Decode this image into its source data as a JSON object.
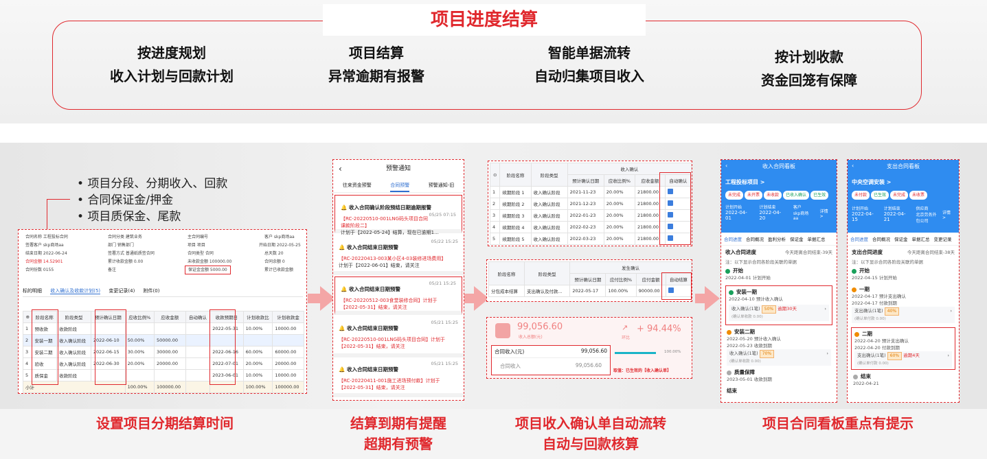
{
  "header": {
    "title": "项目进度结算"
  },
  "features": [
    {
      "l1": "按进度规划",
      "l2": "收入计划与回款计划"
    },
    {
      "l1": "项目结算",
      "l2": "异常逾期有报警"
    },
    {
      "l1": "智能单据流转",
      "l2": "自动归集项目收入"
    },
    {
      "l1": "按计划收款",
      "l2": "资金回笼有保障"
    }
  ],
  "bullets": [
    "项目分段、分期收入、回款",
    "合同保证金/押金",
    "项目质保金、尾款"
  ],
  "captions": {
    "c1": "设置项目分期结算时间",
    "c2a": "结算到期有提醒",
    "c2b": "超期有预警",
    "c3a": "项目收入确认单自动流转",
    "c3b": "自动与回款核算",
    "c4": "项目合同看板重点有提示"
  },
  "panel1": {
    "fields": [
      "合同名称 工程投标合同",
      "合同分类 建筑业务",
      "主合同编号",
      "客户 skp商场aa",
      "签署客户 skp商场aa",
      "部门 销售部门",
      "项目 项目",
      "开始日期 2022-05-25",
      "结束日期 2022-06-24",
      "签署方式 普通纸质签合同",
      "合同类型 合同",
      "总天数 20",
      "合同金额 14.52901",
      "累计收款金额 0.00",
      "未收款金额 100000.00",
      "合同余额 0",
      "合同份数 0155",
      "备注",
      "保证金金额 5000.00",
      "累计已收款金额"
    ],
    "tabs": [
      "标的明细",
      "收入确认及收款计划(5)",
      "变更记录(4)",
      "附件(0)"
    ],
    "head": [
      "阶段名称",
      "阶段类型",
      "预计确认日期",
      "应收比例%",
      "应收金额",
      "自动确认",
      "收款预期日",
      "计划收款比",
      "计划收款金",
      "收款方式"
    ],
    "rows": [
      [
        "预收款",
        "收款阶段",
        "",
        "",
        "",
        "",
        "2022-05-31",
        "10.00%",
        "10000.00"
      ],
      [
        "安装一期",
        "收入确认阶段",
        "2022-06-10",
        "50.00%",
        "50000.00",
        "",
        "",
        "",
        ""
      ],
      [
        "安装二期",
        "收入确认阶段",
        "2022-06-15",
        "30.00%",
        "30000.00",
        "",
        "2022-06-16",
        "60.00%",
        "60000.00"
      ],
      [
        "验收",
        "收入确认阶段",
        "2022-06-30",
        "20.00%",
        "20000.00",
        "",
        "2022-07-01",
        "20.00%",
        "20000.00"
      ],
      [
        "质保金",
        "收款阶段",
        "",
        "",
        "",
        "",
        "2023-06-01",
        "10.00%",
        "10000.00"
      ]
    ],
    "total": [
      "小计",
      "100.00%",
      "100000.00",
      "100.00%",
      "100000.00"
    ]
  },
  "panel2": {
    "title": "预警通知",
    "tabs": [
      "往来资金预警",
      "合同预警",
      "预警通知-旧"
    ],
    "cards": [
      {
        "title": "收入合同确认阶段预结日期逾期报警",
        "time": "05/25 07:15",
        "code": "【RC-20220510-001LNG码头项目合同课款阶段二】",
        "text": "计划于【2022-05-24】结算，现在已逾期1..."
      },
      {
        "title": "收入合同结束日期预警",
        "time": "05/22 15:25",
        "code": "【RC-20220413-003某小区4-03装修进场费用】",
        "text": "计划于【2022-06-01】结束，请关注"
      },
      {
        "title": "收入合同结束日期预警",
        "time": "05/21 15:25",
        "code": "【RC-20220512-003食堂装修合同】计划于",
        "text": "【2022-05-31】结束，请关注"
      },
      {
        "title": "收入合同结束日期预警",
        "time": "05/21 15:25",
        "code": "【RC-20220510-001LNG码头项目合同】计划于",
        "text": "【2022-05-31】结束，请关注"
      },
      {
        "title": "收入合同结束日期预警",
        "time": "05/21 15:25",
        "code": "【RC-20220411-001施工进场预付款】计划于",
        "text": "【2022-05-31】结束，请关注"
      }
    ]
  },
  "panel3": {
    "group": "收入确认",
    "head": [
      "阶段名称",
      "阶段类型",
      "预计确认日期",
      "应收比例%",
      "应收金额",
      "自动确认"
    ],
    "rows": [
      [
        "1",
        "续期阶段 1",
        "收入确认阶段",
        "2021-11-23",
        "20.00%",
        "21800.00"
      ],
      [
        "2",
        "续期阶段 2",
        "收入确认阶段",
        "2021-12-23",
        "20.00%",
        "21800.00"
      ],
      [
        "3",
        "续期阶段 3",
        "收入确认阶段",
        "2022-01-23",
        "20.00%",
        "21800.00"
      ],
      [
        "4",
        "续期阶段 4",
        "收入确认阶段",
        "2022-02-23",
        "20.00%",
        "21800.00"
      ],
      [
        "5",
        "续期阶段 5",
        "收入确认阶段",
        "2022-03-23",
        "20.00%",
        "21800.00"
      ]
    ],
    "t2group": "发生确认",
    "t2head": [
      "阶段名称",
      "阶段类型",
      "预计确认日期",
      "应付比例%",
      "应付金额",
      "自动结算"
    ],
    "t2row": [
      "分包成本结算",
      "支出确认及付款...",
      "2022-05-17",
      "100.00%",
      "90000.00"
    ],
    "amount": "99,056.60",
    "amount_label": "收入总额(元)",
    "growth": "+ 94.44%",
    "growth_label": "环比",
    "row1": [
      "合同收入(元)",
      "99,056.60"
    ],
    "row2": [
      "合同收入",
      "99,056.60"
    ],
    "bar_pct": "100.00%",
    "note": "取值：已生效的【收入确认单】"
  },
  "panel4": {
    "title": "收入合同看板",
    "project": "工程投标项目 >",
    "tags": [
      "未完成",
      "未开票",
      "未收款",
      "已收入确认",
      "已生效"
    ],
    "start_label": "计划开始",
    "start": "2022-04-01",
    "end_label": "计划结束",
    "end": "2022-04-20",
    "client_label": "客户",
    "client": "skp商场aa",
    "detail": "详情 >",
    "tabs": [
      "合同进度",
      "合同概况",
      "盈利分析",
      "保证金",
      "单据汇总"
    ],
    "section": "收入合同进度",
    "remain": "今天距离合同结束-39天",
    "hint": "注：以下显示合同各阶段关联的单据",
    "s_start": "开始",
    "s_start_date": "2022-04-01 计划开始",
    "p1": "安装一期",
    "p1_a": "2022-04-10 预计收入确认",
    "p1_b": "收入确认(1笔)",
    "p1_pct": "50%",
    "p1_late": "逾期30天",
    "p1_c": "(确认单收款 0.00)",
    "p2": "安装二期",
    "p2_a": "2022-05-20 预计收入确认",
    "p2_b": "2022-05-23 收款到期",
    "p2_c": "收入确认(1笔)",
    "p2_pct": "70%",
    "p2_d": "(确认单收款 0.00)",
    "p3": "质量保障",
    "p3_a": "2023-05-01 收款到期",
    "end_step": "结束"
  },
  "panel5": {
    "title": "支出合同看板",
    "project": "中央空调安装 >",
    "tags": [
      "未付款",
      "已生效",
      "未完成",
      "未收票"
    ],
    "start_label": "计划开始",
    "start": "2022-04-15",
    "end_label": "计划结束",
    "end": "2022-04-21",
    "client_label": "供应商",
    "client": "北京劳务外包公司",
    "detail": "详情 >",
    "tabs": [
      "合同进度",
      "合同概况",
      "保证金",
      "单据汇总",
      "变更记录"
    ],
    "section": "支出合同进度",
    "remain": "今天距离合同结束-38天",
    "hint": "注：以下显示合同各阶段关联的单据",
    "s_start": "开始",
    "s_start_date": "2022-04-15 计划开始",
    "p1": "一期",
    "p1_a": "2022-04-17 预计支出确认",
    "p1_b": "2022-04-17 付款到期",
    "p1_c": "支出确认(1笔)",
    "p1_pct": "40%",
    "p1_d": "(确认单付款 0.00)",
    "p2": "二期",
    "p2_a": "2022-04-20 预计支出确认",
    "p2_b": "2022-04-20 付款到期",
    "p2_c": "支出确认(1笔)",
    "p2_pct": "60%",
    "p2_late": "逾期4天",
    "p2_d": "(确认单付款 0.00)",
    "end_step": "结束",
    "end_date": "2022-04-21"
  }
}
